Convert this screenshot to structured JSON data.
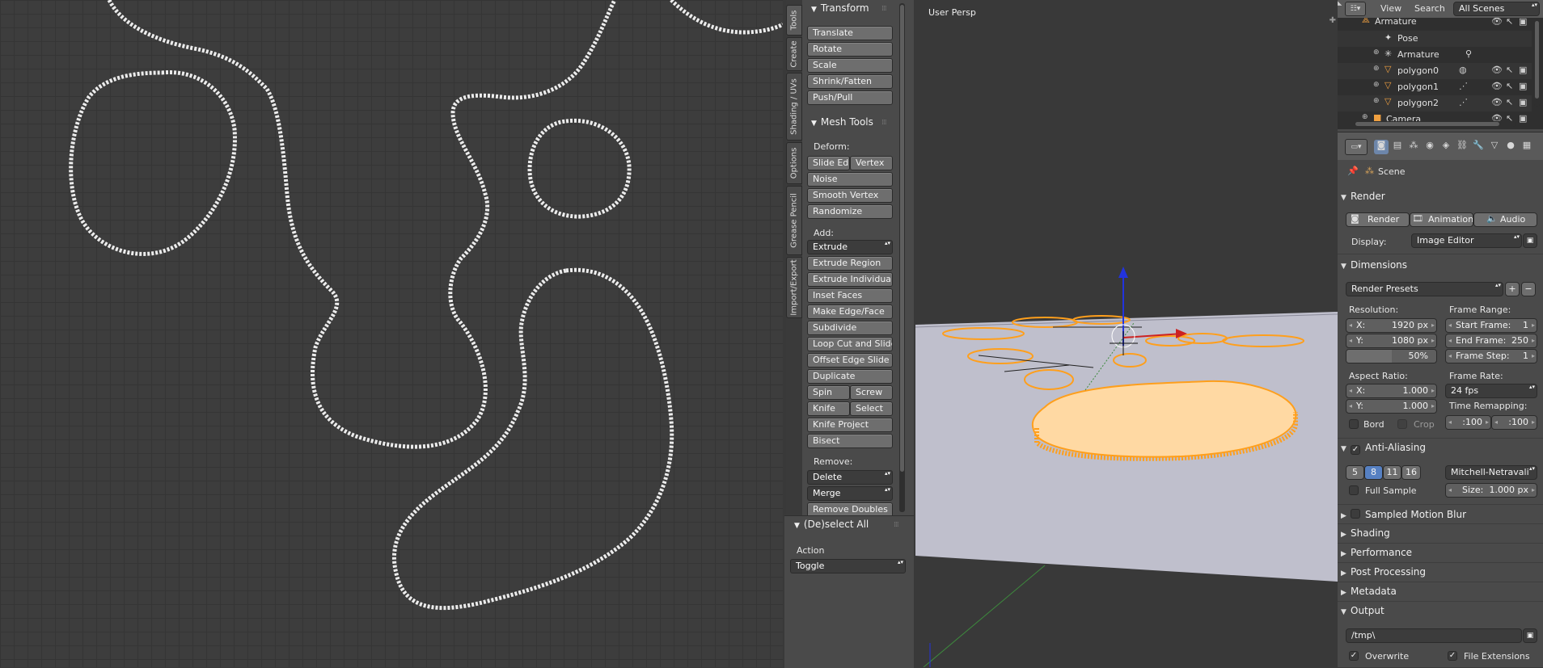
{
  "left_view": {},
  "tool_tabs": [
    "Tools",
    "Create",
    "Shading / UVs",
    "Options",
    "Grease Pencil",
    "Import/Export"
  ],
  "shelf": {
    "transform": {
      "title": "Transform",
      "buttons": [
        "Translate",
        "Rotate",
        "Scale",
        "Shrink/Fatten",
        "Push/Pull"
      ]
    },
    "mesh_tools": {
      "title": "Mesh Tools",
      "deform_label": "Deform:",
      "slide_edge": "Slide Ed",
      "vertex": "Vertex",
      "noise": "Noise",
      "smooth_vertex": "Smooth Vertex",
      "randomize": "Randomize",
      "add_label": "Add:",
      "extrude": "Extrude",
      "add_buttons": [
        "Extrude Region",
        "Extrude Individual",
        "Inset Faces",
        "Make Edge/Face",
        "Subdivide",
        "Loop Cut and Slide",
        "Offset Edge Slide",
        "Duplicate"
      ],
      "spin": "Spin",
      "screw": "Screw",
      "knife": "Knife",
      "select": "Select",
      "knife_project": "Knife Project",
      "bisect": "Bisect",
      "remove_label": "Remove:",
      "delete": "Delete",
      "merge": "Merge",
      "remove_doubles": "Remove Doubles"
    },
    "operator": {
      "title": "(De)select All",
      "action_label": "Action",
      "action_value": "Toggle"
    }
  },
  "view3d": {
    "label": "User Persp",
    "colors": {
      "selection": "#ff9f1c",
      "floor": "#bfbfcc"
    }
  },
  "outliner": {
    "menu": [
      "View",
      "Search"
    ],
    "scene_select": "All Scenes",
    "rows": [
      "Armature",
      "Pose",
      "Armature",
      "polygon0",
      "polygon1",
      "polygon2",
      "Camera"
    ]
  },
  "properties": {
    "scene": "Scene",
    "render": {
      "title": "Render",
      "buttons": [
        "Render",
        "Animation",
        "Audio"
      ],
      "display_label": "Display:",
      "display_value": "Image Editor"
    },
    "dimensions": {
      "title": "Dimensions",
      "presets": "Render Presets",
      "resolution_label": "Resolution:",
      "res_x_label": "X:",
      "res_x": "1920 px",
      "res_y_label": "Y:",
      "res_y": "1080 px",
      "res_pct": "50%",
      "aspect_label": "Aspect Ratio:",
      "asp_x_label": "X:",
      "asp_x": "1.000",
      "asp_y_label": "Y:",
      "asp_y": "1.000",
      "bord": "Bord",
      "crop": "Crop",
      "frame_range_label": "Frame Range:",
      "start_label": "Start Frame:",
      "start": "1",
      "end_label": "End Frame:",
      "end": "250",
      "step_label": "Frame Step:",
      "step": "1",
      "frame_rate_label": "Frame Rate:",
      "fps": "24 fps",
      "time_remap_label": "Time Remapping:",
      "remap_old": ":100",
      "remap_new": ":100"
    },
    "anti_aliasing": {
      "title": "Anti-Aliasing",
      "samples": [
        "5",
        "8",
        "11",
        "16"
      ],
      "filter": "Mitchell-Netravali",
      "full_sample": "Full Sample",
      "size_label": "Size:",
      "size": "1.000 px"
    },
    "collapsed": [
      "Sampled Motion Blur",
      "Shading",
      "Performance",
      "Post Processing",
      "Metadata"
    ],
    "output": {
      "title": "Output",
      "path": "/tmp\\",
      "overwrite": "Overwrite",
      "file_extensions": "File Extensions"
    }
  }
}
